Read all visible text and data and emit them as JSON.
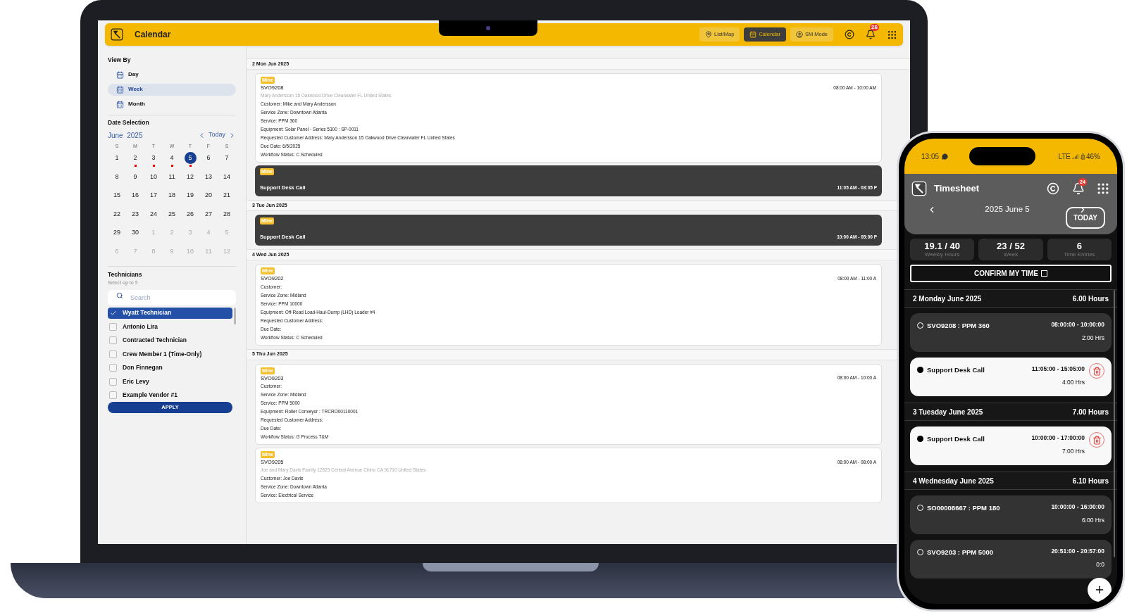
{
  "laptop": {
    "top_bar": {
      "title": "Calendar",
      "buttons": [
        {
          "label": "List/Map",
          "kind": "map",
          "selected": false
        },
        {
          "label": "Calendar",
          "kind": "calendar",
          "selected": true
        },
        {
          "label": "SM Mode",
          "kind": "user",
          "selected": false
        }
      ],
      "notification_count": "26"
    },
    "sidebar": {
      "view_by": {
        "title": "View By",
        "options": [
          {
            "label": "Day",
            "selected": false
          },
          {
            "label": "Week",
            "selected": true
          },
          {
            "label": "Month",
            "selected": false
          }
        ]
      },
      "date_selection": {
        "title": "Date Selection",
        "month": "June",
        "year": "2025",
        "today": "Today",
        "weekdays": [
          "S",
          "M",
          "T",
          "W",
          "T",
          "F",
          "S"
        ],
        "weeks": [
          [
            {
              "label": "1",
              "outside": false,
              "event": false,
              "selected": false
            },
            {
              "label": "2",
              "outside": false,
              "event": true,
              "selected": false
            },
            {
              "label": "3",
              "outside": false,
              "event": true,
              "selected": false
            },
            {
              "label": "4",
              "outside": false,
              "event": true,
              "selected": false
            },
            {
              "label": "5",
              "outside": false,
              "event": true,
              "selected": true
            },
            {
              "label": "6",
              "outside": false,
              "event": false,
              "selected": false
            },
            {
              "label": "7",
              "outside": false,
              "event": false,
              "selected": false
            }
          ],
          [
            {
              "label": "8",
              "outside": false,
              "event": false,
              "selected": false
            },
            {
              "label": "9",
              "outside": false,
              "event": false,
              "selected": false
            },
            {
              "label": "10",
              "outside": false,
              "event": false,
              "selected": false
            },
            {
              "label": "11",
              "outside": false,
              "event": false,
              "selected": false
            },
            {
              "label": "12",
              "outside": false,
              "event": false,
              "selected": false
            },
            {
              "label": "13",
              "outside": false,
              "event": false,
              "selected": false
            },
            {
              "label": "14",
              "outside": false,
              "event": false,
              "selected": false
            }
          ],
          [
            {
              "label": "15",
              "outside": false,
              "event": false,
              "selected": false
            },
            {
              "label": "16",
              "outside": false,
              "event": false,
              "selected": false
            },
            {
              "label": "17",
              "outside": false,
              "event": false,
              "selected": false
            },
            {
              "label": "18",
              "outside": false,
              "event": false,
              "selected": false
            },
            {
              "label": "19",
              "outside": false,
              "event": false,
              "selected": false
            },
            {
              "label": "20",
              "outside": false,
              "event": false,
              "selected": false
            },
            {
              "label": "21",
              "outside": false,
              "event": false,
              "selected": false
            }
          ],
          [
            {
              "label": "22",
              "outside": false,
              "event": false,
              "selected": false
            },
            {
              "label": "23",
              "outside": false,
              "event": false,
              "selected": false
            },
            {
              "label": "24",
              "outside": false,
              "event": false,
              "selected": false
            },
            {
              "label": "25",
              "outside": false,
              "event": false,
              "selected": false
            },
            {
              "label": "26",
              "outside": false,
              "event": false,
              "selected": false
            },
            {
              "label": "27",
              "outside": false,
              "event": false,
              "selected": false
            },
            {
              "label": "28",
              "outside": false,
              "event": false,
              "selected": false
            }
          ],
          [
            {
              "label": "29",
              "outside": false,
              "event": false,
              "selected": false
            },
            {
              "label": "30",
              "outside": false,
              "event": false,
              "selected": false
            },
            {
              "label": "1",
              "outside": true,
              "event": false,
              "selected": false
            },
            {
              "label": "2",
              "outside": true,
              "event": false,
              "selected": false
            },
            {
              "label": "3",
              "outside": true,
              "event": false,
              "selected": false
            },
            {
              "label": "4",
              "outside": true,
              "event": false,
              "selected": false
            },
            {
              "label": "5",
              "outside": true,
              "event": false,
              "selected": false
            }
          ],
          [
            {
              "label": "6",
              "outside": true,
              "event": false,
              "selected": false
            },
            {
              "label": "7",
              "outside": true,
              "event": false,
              "selected": false
            },
            {
              "label": "8",
              "outside": true,
              "event": false,
              "selected": false
            },
            {
              "label": "9",
              "outside": true,
              "event": false,
              "selected": false
            },
            {
              "label": "10",
              "outside": true,
              "event": false,
              "selected": false
            },
            {
              "label": "11",
              "outside": true,
              "event": false,
              "selected": false
            },
            {
              "label": "12",
              "outside": true,
              "event": false,
              "selected": false
            }
          ]
        ]
      },
      "technicians": {
        "title": "Technicians",
        "hint": "Select up to 5",
        "search_placeholder": "Search",
        "items": [
          {
            "name": "Wyatt Technician",
            "checked": true
          },
          {
            "name": "Antonio Lira",
            "checked": false
          },
          {
            "name": "Contracted Technician",
            "checked": false
          },
          {
            "name": "Crew Member 1 (Time-Only)",
            "checked": false
          },
          {
            "name": "Don Finnegan",
            "checked": false
          },
          {
            "name": "Eric Levy",
            "checked": false
          },
          {
            "name": "Example Vendor #1",
            "checked": false
          }
        ],
        "apply": "APPLY"
      }
    },
    "schedule": [
      {
        "date": "2 Mon Jun 2025",
        "events": [
          {
            "kind": "job",
            "badge": "Mine",
            "title": "SVO9208",
            "time": "08:00 AM - 10:00 AM",
            "address": "Mary Andersson 15 Oakwood Drive Clearwater FL United States",
            "details": [
              "Customer: Mike and Mary Andersson",
              "Service Zone: Downtown Atlanta",
              "Service: PPM 360",
              "Equipment: Solar Panel - Series 5300 : SP-0011",
              "Requested Customer Address: Mary Andersson 15 Oakwood Drive Clearwater FL United States",
              "Due Date: 6/5/2025",
              "Workflow Status: C Scheduled"
            ]
          },
          {
            "kind": "call",
            "badge": "Mine",
            "title": "Support Desk Call",
            "time": "11:05 AM - 03:05 P"
          }
        ]
      },
      {
        "date": "3 Tue Jun 2025",
        "events": [
          {
            "kind": "call",
            "badge": "Mine",
            "title": "Support Desk Call",
            "time": "10:00 AM - 05:00 P"
          }
        ]
      },
      {
        "date": "4 Wed Jun 2025",
        "events": [
          {
            "kind": "job",
            "badge": "Mine",
            "title": "SVO9202",
            "time": "08:00 AM - 11:00 A",
            "details": [
              "Customer:",
              "Service Zone: Midland",
              "Service: PPM 10000",
              "Equipment: Off-Road Load-Haul-Dump (LHD) Loader #4",
              "Requested Customer Address:",
              "Due Date:",
              "Workflow Status: C Scheduled"
            ]
          }
        ]
      },
      {
        "date": "5 Thu Jun 2025",
        "events": [
          {
            "kind": "job",
            "badge": "Mine",
            "title": "SVO9203",
            "time": "08:00 AM - 10:00 A",
            "details": [
              "Customer:",
              "Service Zone: Midland",
              "Service: PPM 5000",
              "Equipment: Roller Conveyor : TRCRO00110001",
              "Requested Customer Address:",
              "Due Date:",
              "Workflow Status: G Process T&M"
            ]
          },
          {
            "kind": "job",
            "badge": "Mine",
            "title": "SVO9205",
            "time": "08:00 AM - 08:00 A",
            "address": "Joe and Mary Davis Family 12625 Central Avenue Chino CA 91710 United States",
            "details": [
              "Customer: Joe Davis",
              "Service Zone: Downtown Atlanta",
              "Service: Electrical Service"
            ]
          }
        ]
      }
    ]
  },
  "phone": {
    "status": {
      "time": "13:05",
      "network": "LTE",
      "battery": "46%"
    },
    "header": {
      "title": "Timesheet",
      "notification_count": "24"
    },
    "date_nav": {
      "date": "2025 June 5",
      "today": "TODAY"
    },
    "stats": [
      {
        "value": "19.1 / 40",
        "label": "Weekly Hours"
      },
      {
        "value": "23 / 52",
        "label": "Week"
      },
      {
        "value": "6",
        "label": "Time Entries"
      }
    ],
    "confirm": {
      "label": "CONFIRM MY TIME",
      "checked": false
    },
    "days": [
      {
        "date": "2 Monday June 2025",
        "hours": "6.00 Hours",
        "entries": [
          {
            "kind": "job",
            "title": "SVO9208 : PPM 360",
            "time": "08:00:00 - 10:00:00",
            "duration": "2:00 Hrs"
          },
          {
            "kind": "call",
            "title": "Support Desk Call",
            "time": "11:05:00 - 15:05:00",
            "duration": "4:00 Hrs"
          }
        ]
      },
      {
        "date": "3 Tuesday June 2025",
        "hours": "7.00 Hours",
        "entries": [
          {
            "kind": "call",
            "title": "Support Desk Call",
            "time": "10:00:00 - 17:00:00",
            "duration": "7:00 Hrs"
          }
        ]
      },
      {
        "date": "4 Wednesday June 2025",
        "hours": "6.10 Hours",
        "entries": [
          {
            "kind": "job",
            "title": "SO00008667 : PPM 180",
            "time": "10:00:00 - 16:00:00",
            "duration": "6:00 Hrs"
          },
          {
            "kind": "job",
            "title": "SVO9203 : PPM 5000",
            "time": "20:51:00 - 20:57:00",
            "duration": "0:0"
          }
        ]
      }
    ]
  }
}
